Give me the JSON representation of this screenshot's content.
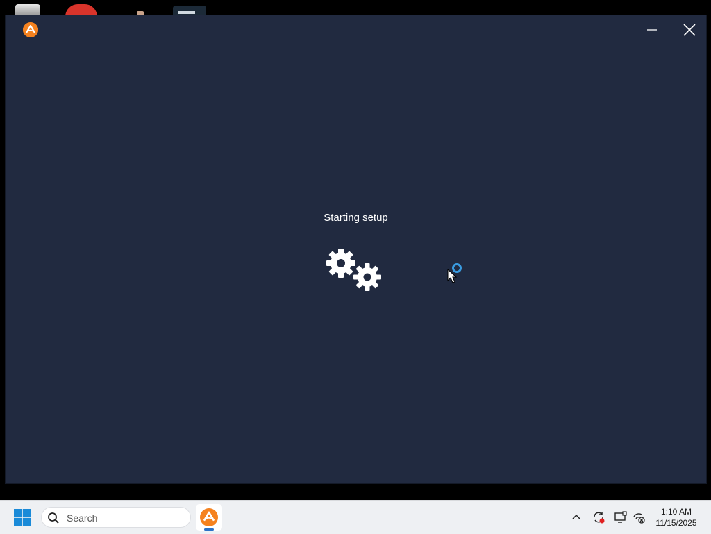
{
  "installer": {
    "status_text": "Starting setup",
    "accent_color": "#f5821f",
    "background_color": "#212a40"
  },
  "window_controls": {
    "minimize_icon": "minimize-icon",
    "close_icon": "close-icon"
  },
  "taskbar": {
    "search_placeholder": "Search",
    "pinned_apps": [
      "installer-app-icon"
    ],
    "tray_icons": [
      "chevron-up-icon",
      "sync-icon",
      "display-icon",
      "network-icon"
    ],
    "time": "1:10 AM",
    "date": "11/15/2025"
  }
}
